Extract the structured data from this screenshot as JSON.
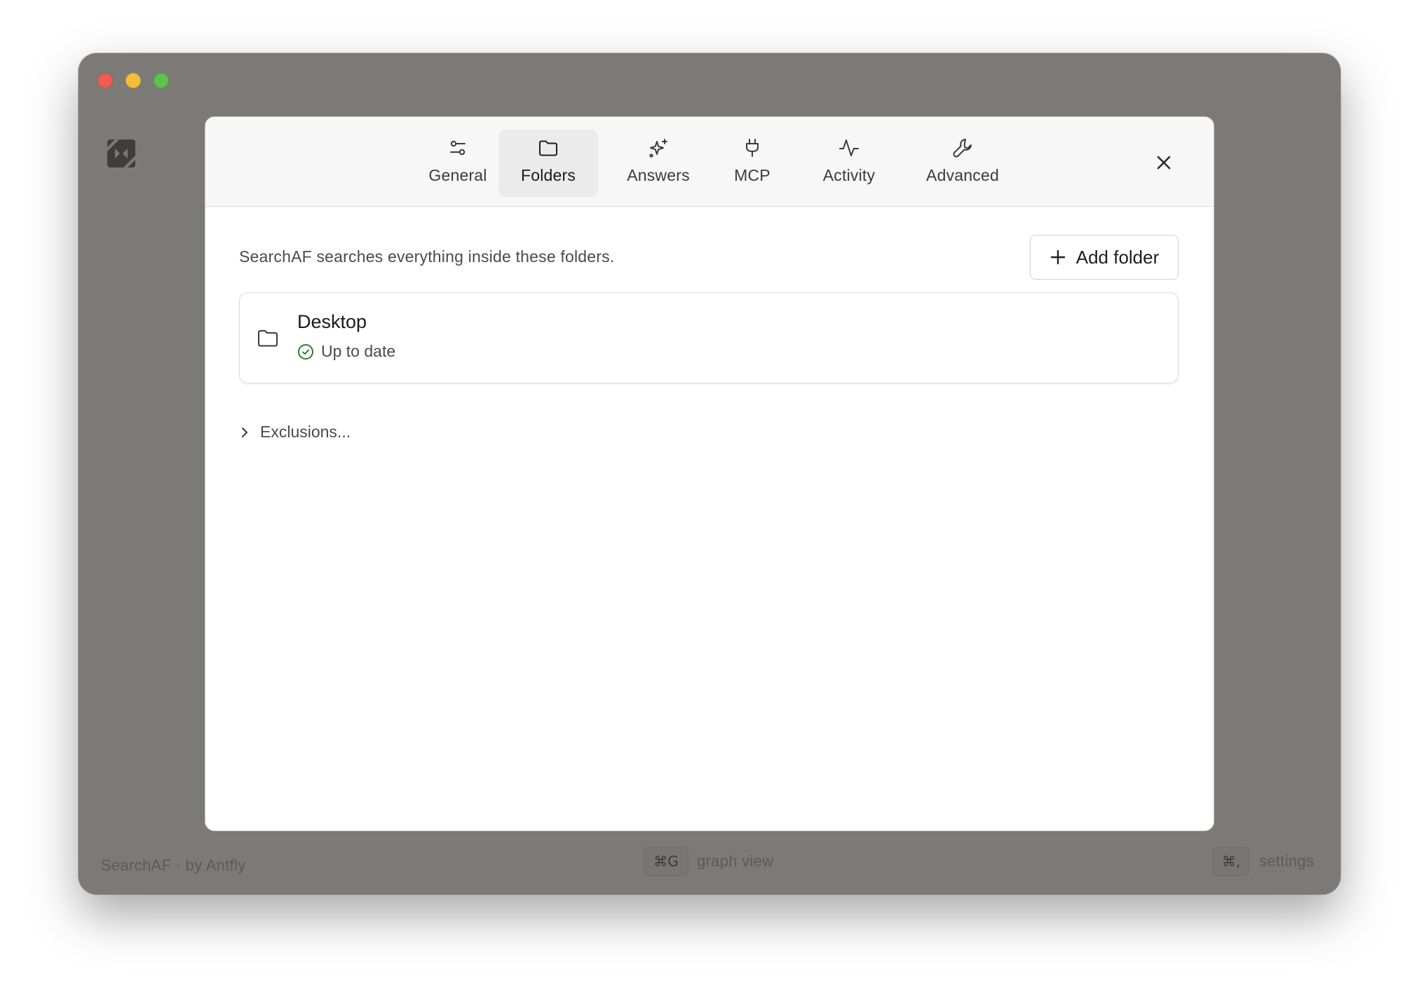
{
  "window": {
    "app_footer_label": "SearchAF · by Antfly"
  },
  "footer": {
    "graph_shortcut": "⌘G",
    "graph_label": "graph view",
    "settings_shortcut": "⌘,",
    "settings_label": "settings"
  },
  "settings": {
    "tabs": [
      {
        "label": "General",
        "icon": "sliders-icon",
        "active": false
      },
      {
        "label": "Folders",
        "icon": "folder-icon",
        "active": true
      },
      {
        "label": "Answers",
        "icon": "sparkles-icon",
        "active": false
      },
      {
        "label": "MCP",
        "icon": "plug-icon",
        "active": false
      },
      {
        "label": "Activity",
        "icon": "activity-icon",
        "active": false
      },
      {
        "label": "Advanced",
        "icon": "wrench-icon",
        "active": false
      }
    ],
    "close_icon": "close-icon"
  },
  "folders_panel": {
    "description": "SearchAF searches everything inside these folders.",
    "add_folder_label": "Add folder",
    "folders": [
      {
        "name": "Desktop",
        "status": "Up to date",
        "status_icon": "check-circle-icon"
      }
    ],
    "exclusions_label": "Exclusions..."
  },
  "colors": {
    "window_bg": "#7b7a77",
    "modal_bg": "#ffffff",
    "header_bg": "#f7f7f7",
    "active_tab_bg": "#ebebeb",
    "status_ok": "#2f7d32"
  }
}
